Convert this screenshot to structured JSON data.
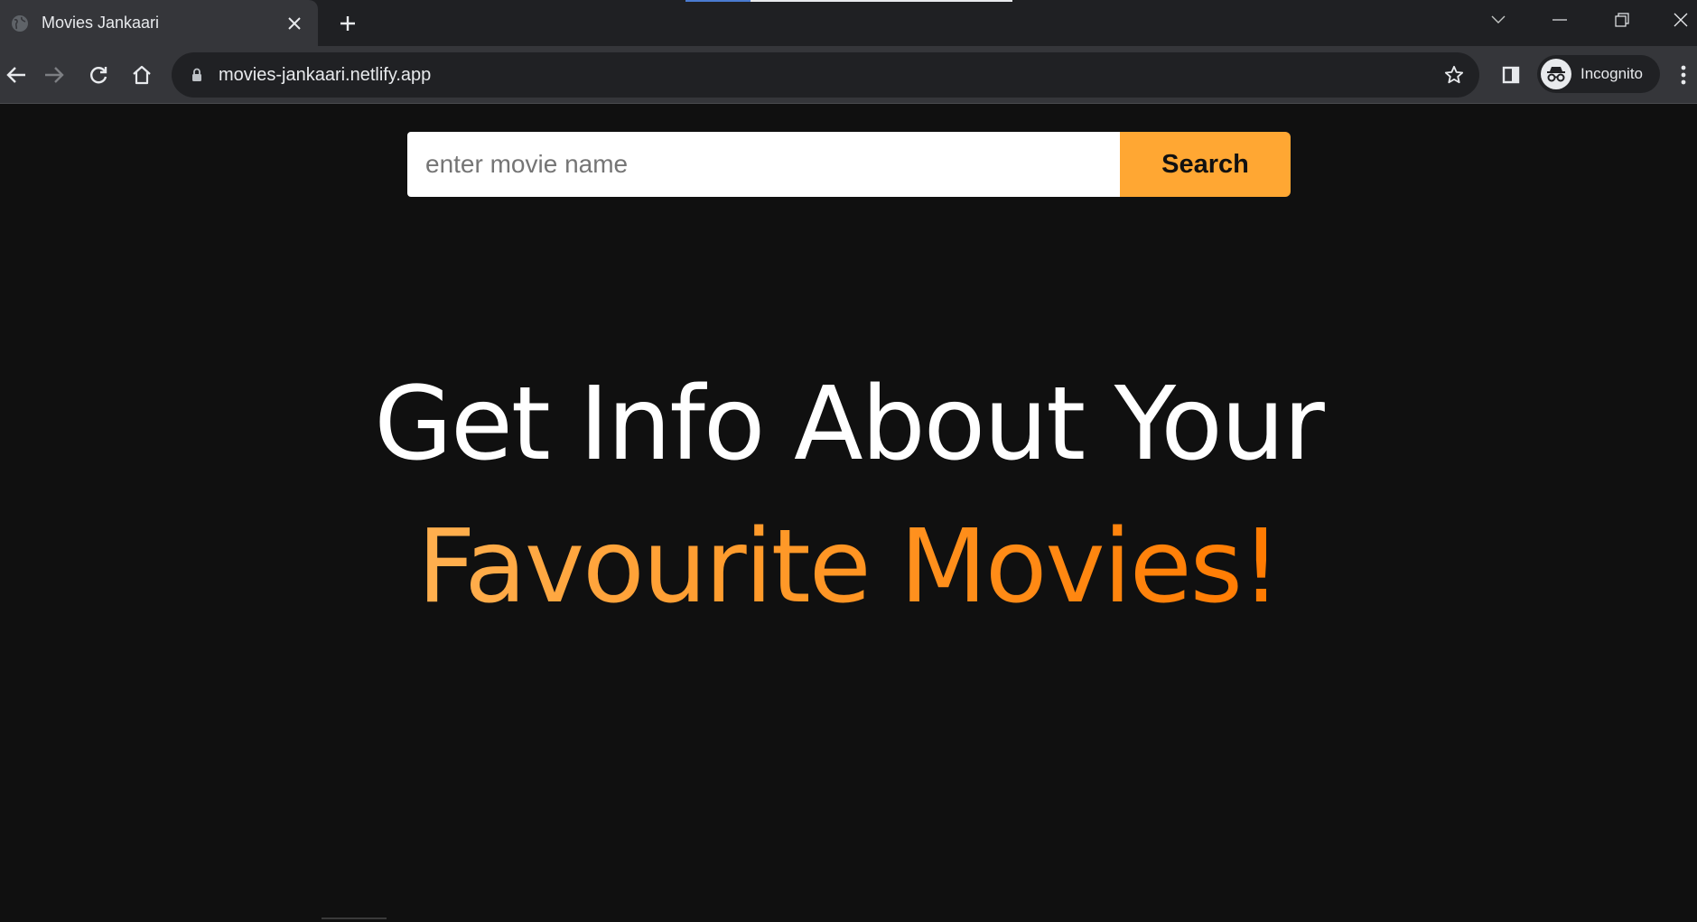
{
  "browser": {
    "tab": {
      "title": "Movies Jankaari",
      "favicon": "globe-icon"
    },
    "new_tab_icon": "plus-icon",
    "window_controls": [
      "tab-search-icon",
      "minimize-icon",
      "restore-icon",
      "close-icon"
    ],
    "toolbar": {
      "url": "movies-jankaari.netlify.app",
      "incognito_label": "Incognito"
    }
  },
  "page": {
    "search": {
      "placeholder": "enter movie name",
      "value": "",
      "button_label": "Search"
    },
    "hero": {
      "line1": "Get Info About Your",
      "line2": "Favourite Movies!"
    }
  },
  "colors": {
    "page_background": "#101010",
    "accent": "#ffa733",
    "hero_gradient_start": "#ffb050",
    "hero_gradient_end": "#ff7a00"
  }
}
